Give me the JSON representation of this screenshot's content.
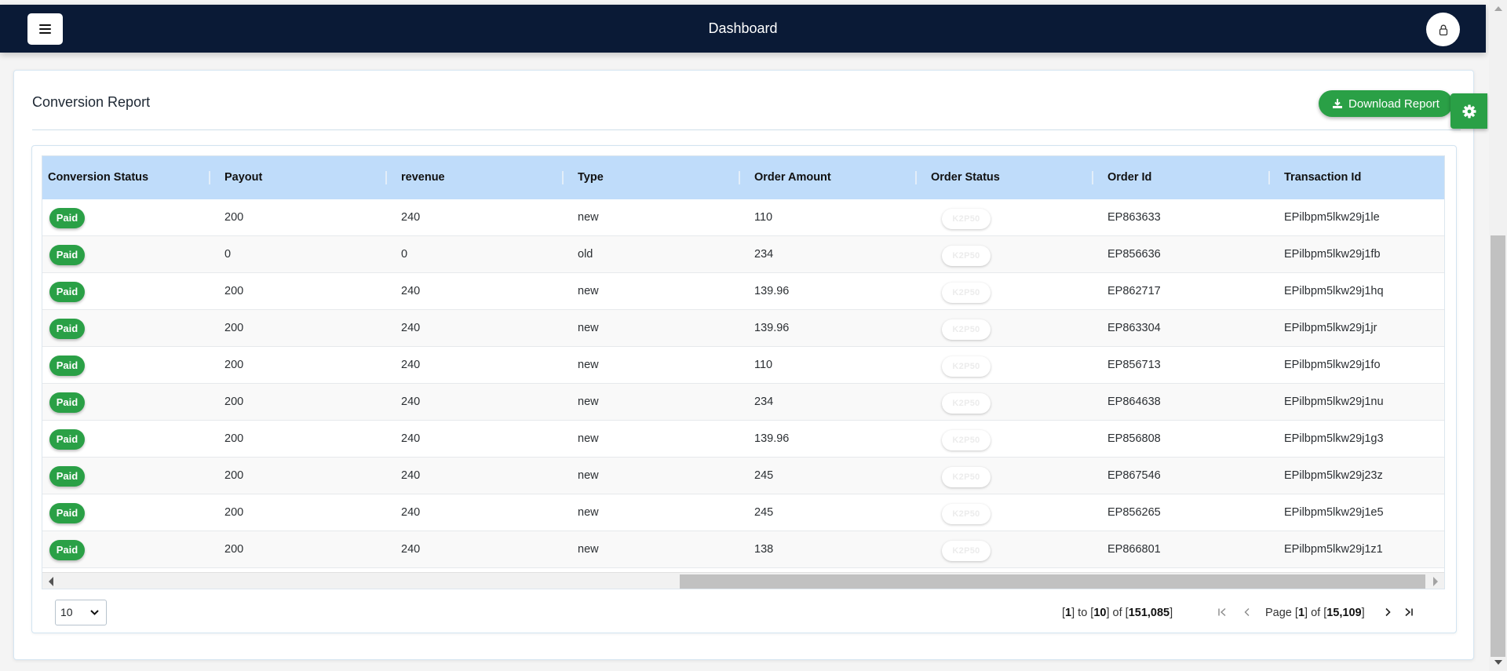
{
  "header": {
    "title": "Dashboard",
    "menu_icon": "hamburger-menu-icon",
    "user_icon": "user-lock-icon"
  },
  "report": {
    "title": "Conversion Report",
    "download_label": "Download Report",
    "download_icon": "download-icon",
    "settings_icon": "gear-icon"
  },
  "table": {
    "columns": [
      "Conversion Status",
      "Payout",
      "revenue",
      "Type",
      "Order Amount",
      "Order Status",
      "Order Id",
      "Transaction Id"
    ],
    "rows": [
      {
        "status": "Paid",
        "payout": "200",
        "revenue": "240",
        "type": "new",
        "amount": "110",
        "order_status": "K2P50",
        "order_id": "EP863633",
        "txn_id": "EPilbpm5lkw29j1le"
      },
      {
        "status": "Paid",
        "payout": "0",
        "revenue": "0",
        "type": "old",
        "amount": "234",
        "order_status": "K2P50",
        "order_id": "EP856636",
        "txn_id": "EPilbpm5lkw29j1fb"
      },
      {
        "status": "Paid",
        "payout": "200",
        "revenue": "240",
        "type": "new",
        "amount": "139.96",
        "order_status": "K2P50",
        "order_id": "EP862717",
        "txn_id": "EPilbpm5lkw29j1hq"
      },
      {
        "status": "Paid",
        "payout": "200",
        "revenue": "240",
        "type": "new",
        "amount": "139.96",
        "order_status": "K2P50",
        "order_id": "EP863304",
        "txn_id": "EPilbpm5lkw29j1jr"
      },
      {
        "status": "Paid",
        "payout": "200",
        "revenue": "240",
        "type": "new",
        "amount": "110",
        "order_status": "K2P50",
        "order_id": "EP856713",
        "txn_id": "EPilbpm5lkw29j1fo"
      },
      {
        "status": "Paid",
        "payout": "200",
        "revenue": "240",
        "type": "new",
        "amount": "234",
        "order_status": "K2P50",
        "order_id": "EP864638",
        "txn_id": "EPilbpm5lkw29j1nu"
      },
      {
        "status": "Paid",
        "payout": "200",
        "revenue": "240",
        "type": "new",
        "amount": "139.96",
        "order_status": "K2P50",
        "order_id": "EP856808",
        "txn_id": "EPilbpm5lkw29j1g3"
      },
      {
        "status": "Paid",
        "payout": "200",
        "revenue": "240",
        "type": "new",
        "amount": "245",
        "order_status": "K2P50",
        "order_id": "EP867546",
        "txn_id": "EPilbpm5lkw29j23z"
      },
      {
        "status": "Paid",
        "payout": "200",
        "revenue": "240",
        "type": "new",
        "amount": "245",
        "order_status": "K2P50",
        "order_id": "EP856265",
        "txn_id": "EPilbpm5lkw29j1e5"
      },
      {
        "status": "Paid",
        "payout": "200",
        "revenue": "240",
        "type": "new",
        "amount": "138",
        "order_status": "K2P50",
        "order_id": "EP866801",
        "txn_id": "EPilbpm5lkw29j1z1"
      }
    ]
  },
  "pagination": {
    "page_size": "10",
    "from": "1",
    "to": "10",
    "total": "151,085",
    "page": "1",
    "page_count": "15,109",
    "to_word": "to",
    "of_word": "of",
    "page_word": "Page"
  },
  "colors": {
    "navbar": "#0a1a36",
    "accent_green": "#2aa046",
    "table_header": "#bfdcfa"
  }
}
